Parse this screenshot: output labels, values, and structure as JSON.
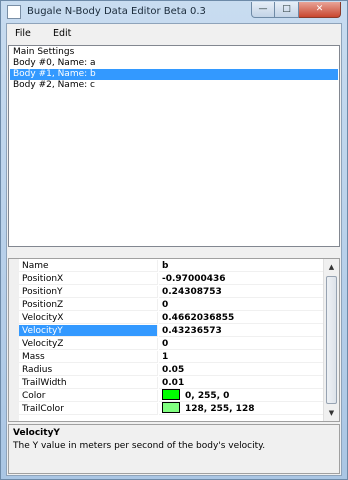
{
  "window": {
    "title": "Bugale N-Body Data Editor Beta 0.3",
    "minimize_glyph": "—",
    "maximize_glyph": "□",
    "close_glyph": "✕"
  },
  "menu": {
    "file": "File",
    "edit": "Edit"
  },
  "body_list": {
    "items": [
      {
        "label": "Main Settings",
        "selected": false
      },
      {
        "label": "Body #0, Name: a",
        "selected": false
      },
      {
        "label": "Body #1, Name: b",
        "selected": true
      },
      {
        "label": "Body #2, Name: c",
        "selected": false
      }
    ]
  },
  "property_grid": {
    "rows": [
      {
        "name": "Name",
        "value": "b"
      },
      {
        "name": "PositionX",
        "value": "-0.97000436"
      },
      {
        "name": "PositionY",
        "value": "0.24308753"
      },
      {
        "name": "PositionZ",
        "value": "0"
      },
      {
        "name": "VelocityX",
        "value": "0.4662036855"
      },
      {
        "name": "VelocityY",
        "value": "0.43236573",
        "selected": true
      },
      {
        "name": "VelocityZ",
        "value": "0"
      },
      {
        "name": "Mass",
        "value": "1"
      },
      {
        "name": "Radius",
        "value": "0.05"
      },
      {
        "name": "TrailWidth",
        "value": "0.01"
      },
      {
        "name": "Color",
        "value": "0, 255, 0",
        "swatch": "#00ff00"
      },
      {
        "name": "TrailColor",
        "value": "128, 255, 128",
        "swatch": "#80ff80"
      }
    ],
    "scroll_up_glyph": "▲",
    "scroll_down_glyph": "▼"
  },
  "description": {
    "title": "VelocityY",
    "text": "The Y value in meters per second of the body's velocity."
  },
  "colors": {
    "selection": "#3399ff",
    "color_swatch": "#00ff00",
    "trail_color_swatch": "#80ff80"
  }
}
